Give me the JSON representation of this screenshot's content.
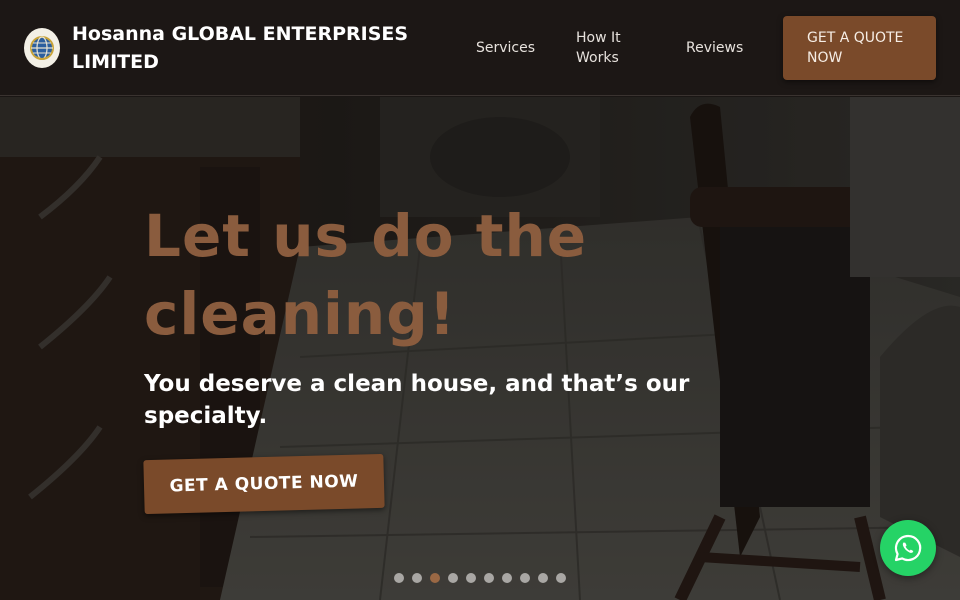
{
  "header": {
    "brand_name": "Hosanna GLOBAL ENTERPRISES LIMITED",
    "logo_icon": "globe-logo-icon",
    "nav": [
      {
        "label": "Services"
      },
      {
        "label": "How It Works"
      },
      {
        "label": "Reviews"
      }
    ],
    "cta_label": "GET A QUOTE NOW"
  },
  "hero": {
    "title": "Let us do the cleaning!",
    "subtitle": "You deserve a clean house, and that’s our specialty.",
    "cta_label": "GET A QUOTE NOW",
    "slider": {
      "slide_count": 10,
      "active_index": 2
    }
  },
  "floating": {
    "whatsapp_icon": "whatsapp-icon"
  },
  "colors": {
    "accent": "#7a4a2a",
    "title": "#8a5c3e",
    "header_bg": "#1c1715",
    "whatsapp": "#25d366"
  }
}
